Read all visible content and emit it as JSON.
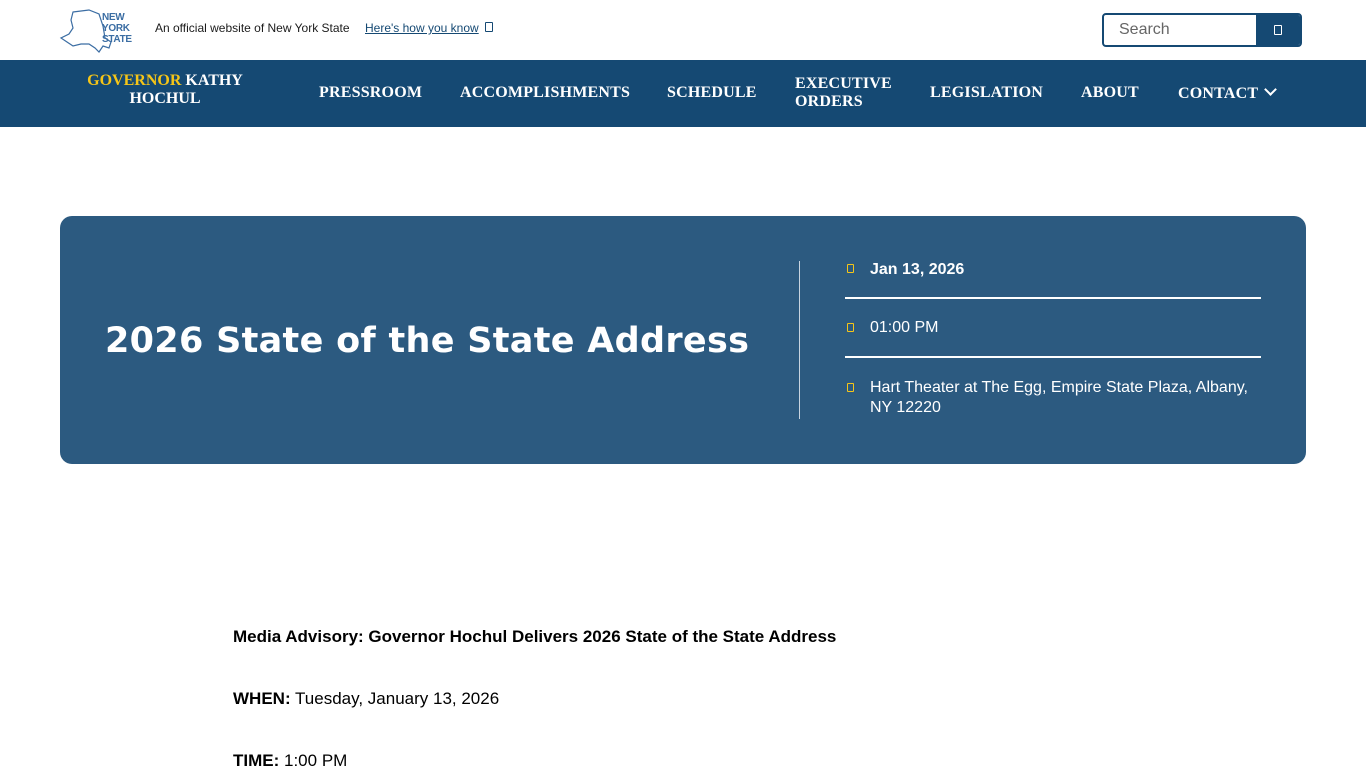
{
  "utility": {
    "logo_line1": "NEW",
    "logo_line2": "YORK",
    "logo_line3": "STATE",
    "official_text": "An official website of New York State",
    "how_you_know": "Here's how you know",
    "search_placeholder": "Search"
  },
  "nav": {
    "brand_gov": "GOVERNOR",
    "brand_name1": " KATHY",
    "brand_name2": "HOCHUL",
    "items": [
      "PRESSROOM",
      "ACCOMPLISHMENTS",
      "SCHEDULE",
      "EXECUTIVE",
      "ORDERS",
      "LEGISLATION",
      "ABOUT",
      "CONTACT"
    ]
  },
  "hero": {
    "title": "2026 State of the State Address",
    "date": "Jan 13, 2026",
    "time": "01:00 PM",
    "location_line1": "Hart Theater at The Egg, Empire State Plaza, Albany,",
    "location_line2": "NY 12220"
  },
  "content": {
    "advisory": "Media Advisory: Governor Hochul Delivers 2026 State of the State Address",
    "when_label": "WHEN:",
    "when_value": " Tuesday, January 13, 2026",
    "time_label": "TIME:",
    "time_value": " 1:00 PM"
  },
  "colors": {
    "nav_bg": "#154973",
    "hero_bg": "#2c5a80",
    "accent_gold": "#f5c518"
  }
}
